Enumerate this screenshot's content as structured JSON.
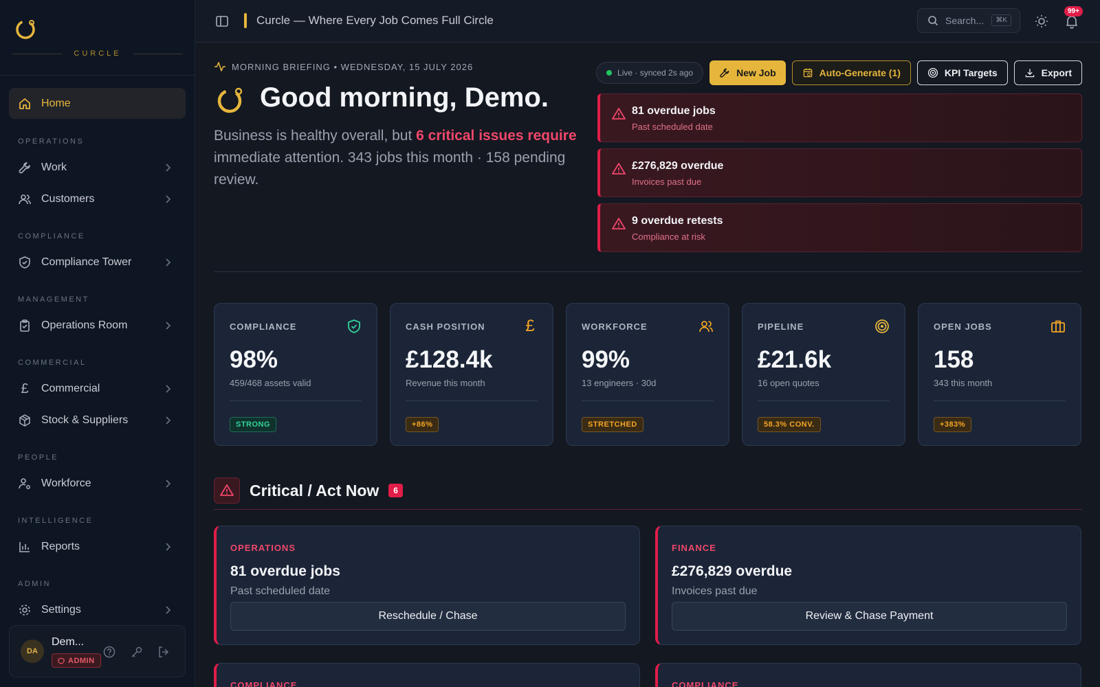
{
  "app": {
    "logo_text": "CURCLE",
    "title": "Curcle — Where Every Job Comes Full Circle"
  },
  "topbar": {
    "search_placeholder": "Search...",
    "search_kbd": "⌘K",
    "notifications_badge": "99+"
  },
  "sidebar": {
    "home": "Home",
    "sections": {
      "operations": "OPERATIONS",
      "compliance": "COMPLIANCE",
      "management": "MANAGEMENT",
      "commercial": "COMMERCIAL",
      "people": "PEOPLE",
      "intelligence": "INTELLIGENCE",
      "admin": "ADMIN"
    },
    "items": {
      "work": "Work",
      "customers": "Customers",
      "compliance_tower": "Compliance Tower",
      "operations_room": "Operations Room",
      "commercial": "Commercial",
      "stock": "Stock & Suppliers",
      "workforce": "Workforce",
      "reports": "Reports",
      "settings": "Settings"
    },
    "user": {
      "initials": "DA",
      "name": "Dem...",
      "role": "ADMIN"
    }
  },
  "briefing": {
    "label": "MORNING BRIEFING • WEDNESDAY, 15 JULY 2026",
    "greeting": "Good morning, Demo.",
    "summary_pre": "Business is healthy overall, but ",
    "summary_highlight": "6 critical issues require",
    "summary_post": " immediate attention. 343 jobs this month · 158 pending review."
  },
  "actions": {
    "live": "Live · synced 2s ago",
    "new_job": "New Job",
    "auto_generate": "Auto-Generate (1)",
    "kpi_targets": "KPI Targets",
    "export": "Export"
  },
  "alerts": [
    {
      "title": "81 overdue jobs",
      "sub": "Past scheduled date"
    },
    {
      "title": "£276,829 overdue",
      "sub": "Invoices past due"
    },
    {
      "title": "9 overdue retests",
      "sub": "Compliance at risk"
    }
  ],
  "kpis": [
    {
      "label": "COMPLIANCE",
      "value": "98%",
      "sub": "459/468 assets valid",
      "badge": "STRONG",
      "icon": "shield-check-icon",
      "color": "#34d399"
    },
    {
      "label": "CASH POSITION",
      "value": "£128.4k",
      "sub": "Revenue this month",
      "badge": "+86%",
      "icon": "pound-icon",
      "color": "#f5a524"
    },
    {
      "label": "WORKFORCE",
      "value": "99%",
      "sub": "13 engineers · 30d",
      "badge": "STRETCHED",
      "icon": "users-icon",
      "color": "#f5a524"
    },
    {
      "label": "PIPELINE",
      "value": "£21.6k",
      "sub": "16 open quotes",
      "badge": "58.3% CONV.",
      "icon": "target-icon",
      "color": "#e6b63c"
    },
    {
      "label": "OPEN JOBS",
      "value": "158",
      "sub": "343 this month",
      "badge": "+383%",
      "icon": "briefcase-icon",
      "color": "#f5a524"
    }
  ],
  "critical": {
    "title": "Critical / Act Now",
    "count": "6",
    "cards": [
      {
        "category": "OPERATIONS",
        "title": "81 overdue jobs",
        "sub": "Past scheduled date",
        "action": "Reschedule / Chase"
      },
      {
        "category": "FINANCE",
        "title": "£276,829 overdue",
        "sub": "Invoices past due",
        "action": "Review & Chase Payment"
      },
      {
        "category": "COMPLIANCE"
      },
      {
        "category": "COMPLIANCE"
      }
    ]
  }
}
